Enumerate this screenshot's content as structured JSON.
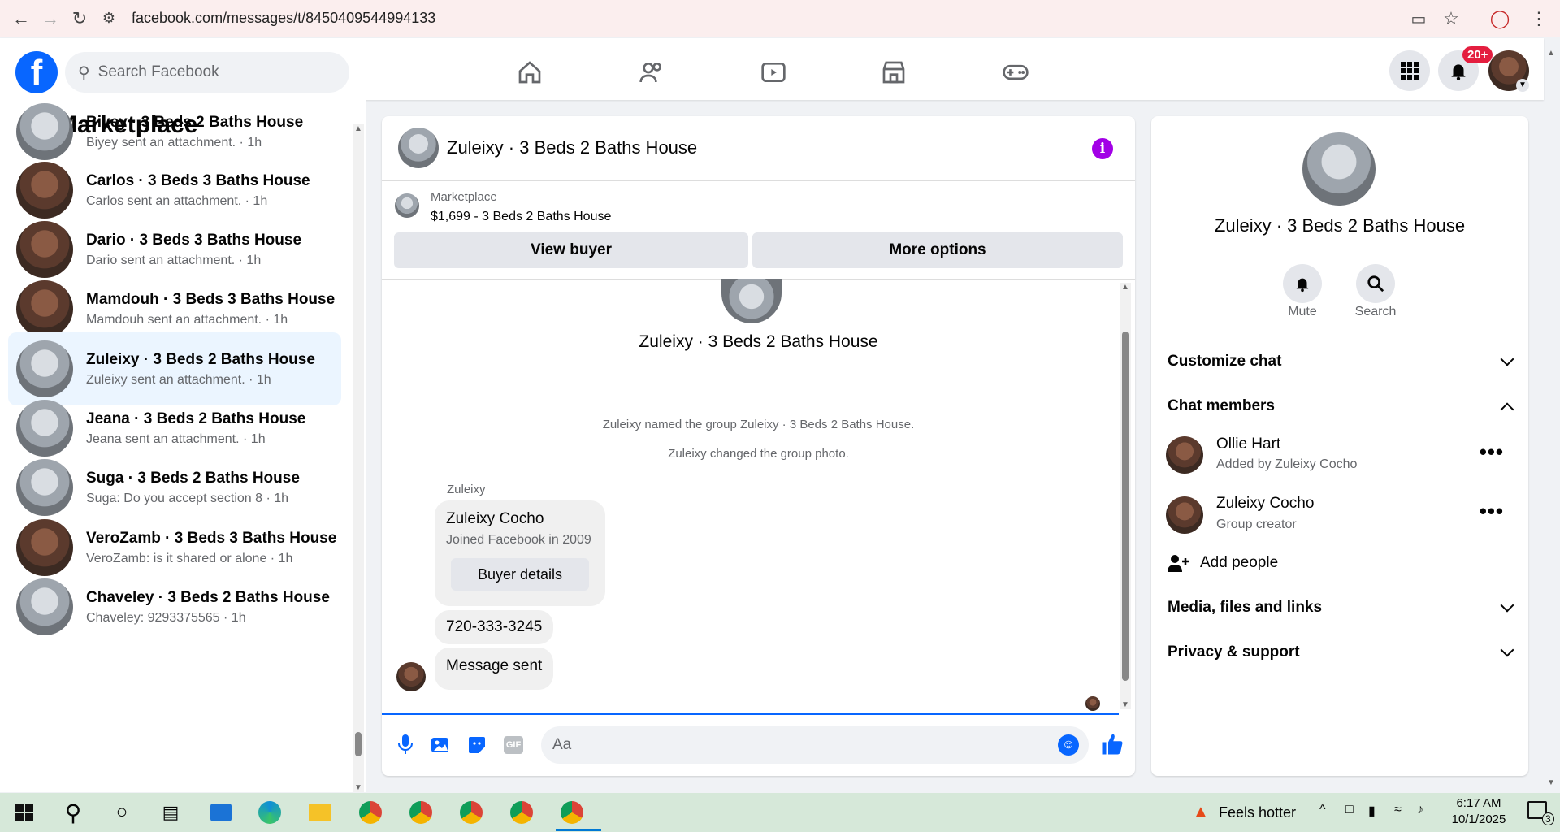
{
  "browser": {
    "url": "facebook.com/messages/t/8450409544994133"
  },
  "header": {
    "search_placeholder": "Search Facebook",
    "notification_badge": "20+"
  },
  "sidebar": {
    "title": "Marketplace",
    "conversations": [
      {
        "title": "Biyey · 3 Beds 2 Baths House",
        "subtitle": "Biyey sent an attachment. · 1h",
        "thumb": "gray"
      },
      {
        "title": "Carlos · 3 Beds 3 Baths House",
        "subtitle": "Carlos sent an attachment. · 1h",
        "thumb": "brown"
      },
      {
        "title": "Dario · 3 Beds 3 Baths House",
        "subtitle": "Dario sent an attachment. · 1h",
        "thumb": "brown"
      },
      {
        "title": "Mamdouh · 3 Beds 3 Baths House",
        "subtitle": "Mamdouh sent an attachment. · 1h",
        "thumb": "brown"
      },
      {
        "title": "Zuleixy · 3 Beds 2 Baths House",
        "subtitle": "Zuleixy sent an attachment. · 1h",
        "thumb": "gray",
        "active": true
      },
      {
        "title": "Jeana · 3 Beds 2 Baths House",
        "subtitle": "Jeana sent an attachment. · 1h",
        "thumb": "gray"
      },
      {
        "title": "Suga · 3 Beds 2 Baths House",
        "subtitle": "Suga: Do you accept section 8 · 1h",
        "thumb": "gray"
      },
      {
        "title": "VeroZamb · 3 Beds 3 Baths House",
        "subtitle": "VeroZamb: is it shared or alone · 1h",
        "thumb": "brown"
      },
      {
        "title": "Chaveley · 3 Beds 2 Baths House",
        "subtitle": "Chaveley: 9293375565 · 1h",
        "thumb": "gray"
      }
    ]
  },
  "chat": {
    "title": "Zuleixy · 3 Beds 2 Baths House",
    "listing_source": "Marketplace",
    "listing_text": "$1,699 - 3 Beds 2 Baths House",
    "view_buyer": "View buyer",
    "more_options": "More options",
    "group_name": "Zuleixy · 3 Beds 2 Baths House",
    "system_1": "Zuleixy named the group Zuleixy · 3 Beds 2 Baths House.",
    "system_2": "Zuleixy changed the group photo.",
    "sender": "Zuleixy",
    "card_name": "Zuleixy Cocho",
    "card_joined": "Joined Facebook in 2009",
    "card_button": "Buyer details",
    "phone_msg": "720-333-3245",
    "sent_msg": "Message sent",
    "composer_placeholder": "Aa"
  },
  "info": {
    "name": "Zuleixy · 3 Beds 2 Baths House",
    "mute": "Mute",
    "search": "Search",
    "customize": "Customize chat",
    "members_title": "Chat members",
    "members": [
      {
        "name": "Ollie Hart",
        "role": "Added by Zuleixy Cocho"
      },
      {
        "name": "Zuleixy Cocho",
        "role": "Group creator"
      }
    ],
    "add_people": "Add people",
    "media": "Media, files and links",
    "privacy": "Privacy & support"
  },
  "taskbar": {
    "weather": "Feels hotter",
    "time": "6:17 AM",
    "date": "10/1/2025",
    "notif_count": "3"
  },
  "colors": {
    "fb_blue": "#0866ff",
    "active_bg": "#ebf5ff",
    "badge_red": "#e41e3f",
    "info_purple": "#a200e6"
  }
}
